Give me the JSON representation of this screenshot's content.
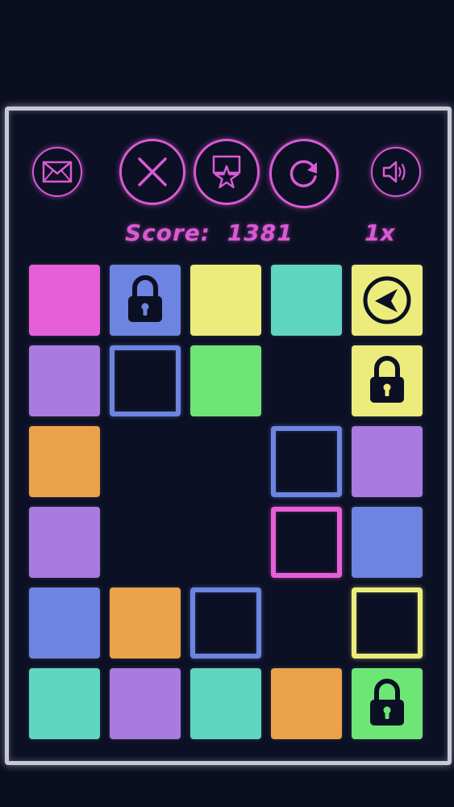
{
  "game": {
    "score_label": "Score:",
    "score_value": "1381",
    "multiplier": "1x"
  },
  "buttons": [
    {
      "name": "mail-button",
      "icon": "mail-icon"
    },
    {
      "name": "close-button",
      "icon": "close-icon"
    },
    {
      "name": "rate-button",
      "icon": "star-badge-icon"
    },
    {
      "name": "restart-button",
      "icon": "restart-icon"
    },
    {
      "name": "sound-button",
      "icon": "speaker-icon"
    }
  ],
  "colors": {
    "pink": "#e75fd8",
    "blue": "#6d84e0",
    "yellow": "#ecec7c",
    "teal": "#5fd6bf",
    "purple": "#a97ae0",
    "green": "#6ee676",
    "orange": "#eba24a",
    "accent": "#d95ad3",
    "frame": "#c9c9d6"
  },
  "grid": {
    "rows": 6,
    "cols": 5,
    "tiles": [
      {
        "row": 0,
        "col": 0,
        "color": "pink",
        "style": "filled",
        "icon": ""
      },
      {
        "row": 0,
        "col": 1,
        "color": "blue",
        "style": "filled",
        "icon": "lock-icon"
      },
      {
        "row": 0,
        "col": 2,
        "color": "yellow",
        "style": "filled",
        "icon": ""
      },
      {
        "row": 0,
        "col": 3,
        "color": "teal",
        "style": "filled",
        "icon": ""
      },
      {
        "row": 0,
        "col": 4,
        "color": "yellow",
        "style": "filled",
        "icon": "arrow-left-icon"
      },
      {
        "row": 1,
        "col": 0,
        "color": "purple",
        "style": "filled",
        "icon": ""
      },
      {
        "row": 1,
        "col": 1,
        "color": "blue",
        "style": "outline",
        "icon": ""
      },
      {
        "row": 1,
        "col": 2,
        "color": "green",
        "style": "filled",
        "icon": ""
      },
      {
        "row": 1,
        "col": 4,
        "color": "yellow",
        "style": "filled",
        "icon": "lock-icon"
      },
      {
        "row": 2,
        "col": 0,
        "color": "orange",
        "style": "filled",
        "icon": ""
      },
      {
        "row": 2,
        "col": 3,
        "color": "blue",
        "style": "outline",
        "icon": ""
      },
      {
        "row": 2,
        "col": 4,
        "color": "purple",
        "style": "filled",
        "icon": ""
      },
      {
        "row": 3,
        "col": 0,
        "color": "purple",
        "style": "filled",
        "icon": ""
      },
      {
        "row": 3,
        "col": 3,
        "color": "pink",
        "style": "outline",
        "icon": ""
      },
      {
        "row": 3,
        "col": 4,
        "color": "blue",
        "style": "filled",
        "icon": ""
      },
      {
        "row": 4,
        "col": 0,
        "color": "blue",
        "style": "filled",
        "icon": ""
      },
      {
        "row": 4,
        "col": 1,
        "color": "orange",
        "style": "filled",
        "icon": ""
      },
      {
        "row": 4,
        "col": 2,
        "color": "blue",
        "style": "outline",
        "icon": ""
      },
      {
        "row": 4,
        "col": 4,
        "color": "yellow",
        "style": "outline",
        "icon": ""
      },
      {
        "row": 5,
        "col": 0,
        "color": "teal",
        "style": "filled",
        "icon": ""
      },
      {
        "row": 5,
        "col": 1,
        "color": "purple",
        "style": "filled",
        "icon": ""
      },
      {
        "row": 5,
        "col": 2,
        "color": "teal",
        "style": "filled",
        "icon": ""
      },
      {
        "row": 5,
        "col": 3,
        "color": "orange",
        "style": "filled",
        "icon": ""
      },
      {
        "row": 5,
        "col": 4,
        "color": "green",
        "style": "filled",
        "icon": "lock-icon"
      }
    ]
  }
}
